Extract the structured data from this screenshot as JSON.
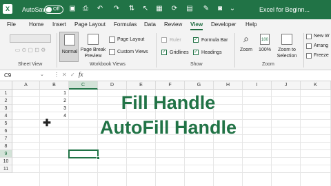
{
  "titlebar": {
    "autosave_label": "AutoSave",
    "toggle_state": "Off",
    "doc_title": "Excel for Beginn..."
  },
  "ribbon_tabs": [
    "File",
    "Home",
    "Insert",
    "Page Layout",
    "Formulas",
    "Data",
    "Review",
    "View",
    "Developer",
    "Help"
  ],
  "active_tab": "View",
  "ribbon": {
    "sheet_view_group": "Sheet View",
    "workbook_views_group": "Workbook Views",
    "show_group": "Show",
    "zoom_group": "Zoom",
    "normal": "Normal",
    "page_break_1": "Page Break",
    "page_break_2": "Preview",
    "page_layout": "Page Layout",
    "custom_views": "Custom Views",
    "ruler": "Ruler",
    "formula_bar": "Formula Bar",
    "gridlines": "Gridlines",
    "headings": "Headings",
    "zoom": "Zoom",
    "zoom_100": "100%",
    "zoom_sel_1": "Zoom to",
    "zoom_sel_2": "Selection",
    "new_window": "New W",
    "arrange": "Arrang",
    "freeze": "Freeze"
  },
  "formula_bar": {
    "name_box": "C9",
    "fx": "fx"
  },
  "columns": [
    "A",
    "B",
    "C",
    "D",
    "E",
    "F",
    "G",
    "H",
    "I",
    "J",
    "K"
  ],
  "selected_column": "C",
  "rows": [
    "1",
    "2",
    "3",
    "4",
    "5",
    "6",
    "7",
    "8",
    "9",
    "10",
    "11"
  ],
  "selected_row": "9",
  "cells": [
    {
      "ref": "B1",
      "value": "1"
    },
    {
      "ref": "B2",
      "value": "2"
    },
    {
      "ref": "B3",
      "value": "3"
    },
    {
      "ref": "B4",
      "value": "4"
    }
  ],
  "overlay": {
    "line1": "Fill Handle",
    "line2": "AutoFill Handle"
  }
}
